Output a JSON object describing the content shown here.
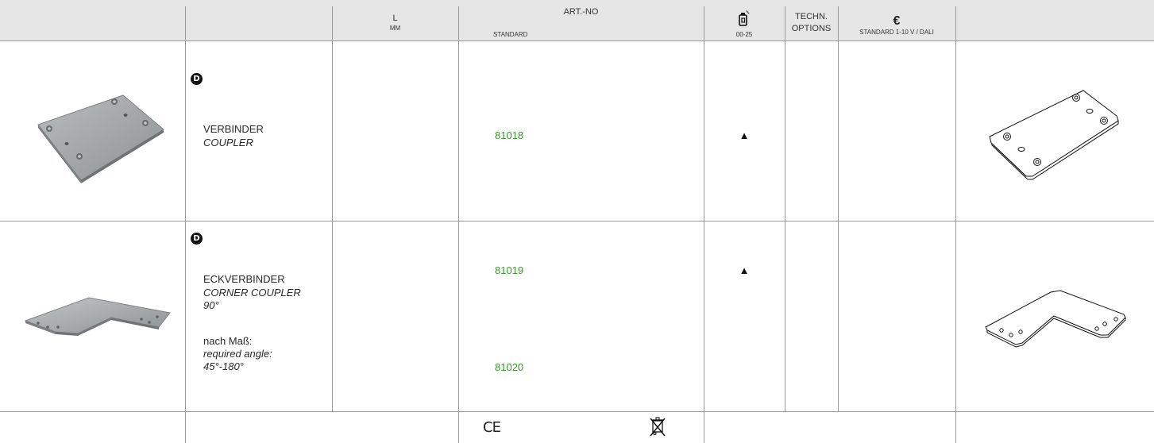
{
  "header": {
    "col_l": "L",
    "col_l_unit": "MM",
    "col_artno": "ART.-NO",
    "col_artno_sub": "STANDARD",
    "col_finish_sub": "00-25",
    "col_techn_1": "TECHN.",
    "col_techn_2": "OPTIONS",
    "col_price_symbol": "€",
    "col_price_sub": "STANDARD  1-10 V / DALI"
  },
  "rows": [
    {
      "badge": "D",
      "name_de": "VERBINDER",
      "name_en": "COUPLER",
      "article": "81018",
      "availability": "▲"
    },
    {
      "badge": "D",
      "name_de": "ECKVERBINDER",
      "name_en_1": "CORNER COUPLER",
      "name_en_2": "90°",
      "custom_de": "nach Maß:",
      "custom_en_1": "required angle:",
      "custom_en_2": "45°-180°",
      "article_1": "81019",
      "article_2": "81020",
      "availability": "▲"
    }
  ],
  "footer": {
    "ce_mark": "CE",
    "weee_icon": "crossed-out-wheelie-bin-icon"
  },
  "colors": {
    "header_bg": "#e6e6e6",
    "article_green": "#3a9a2e",
    "grid_line": "#9a9a9a"
  }
}
